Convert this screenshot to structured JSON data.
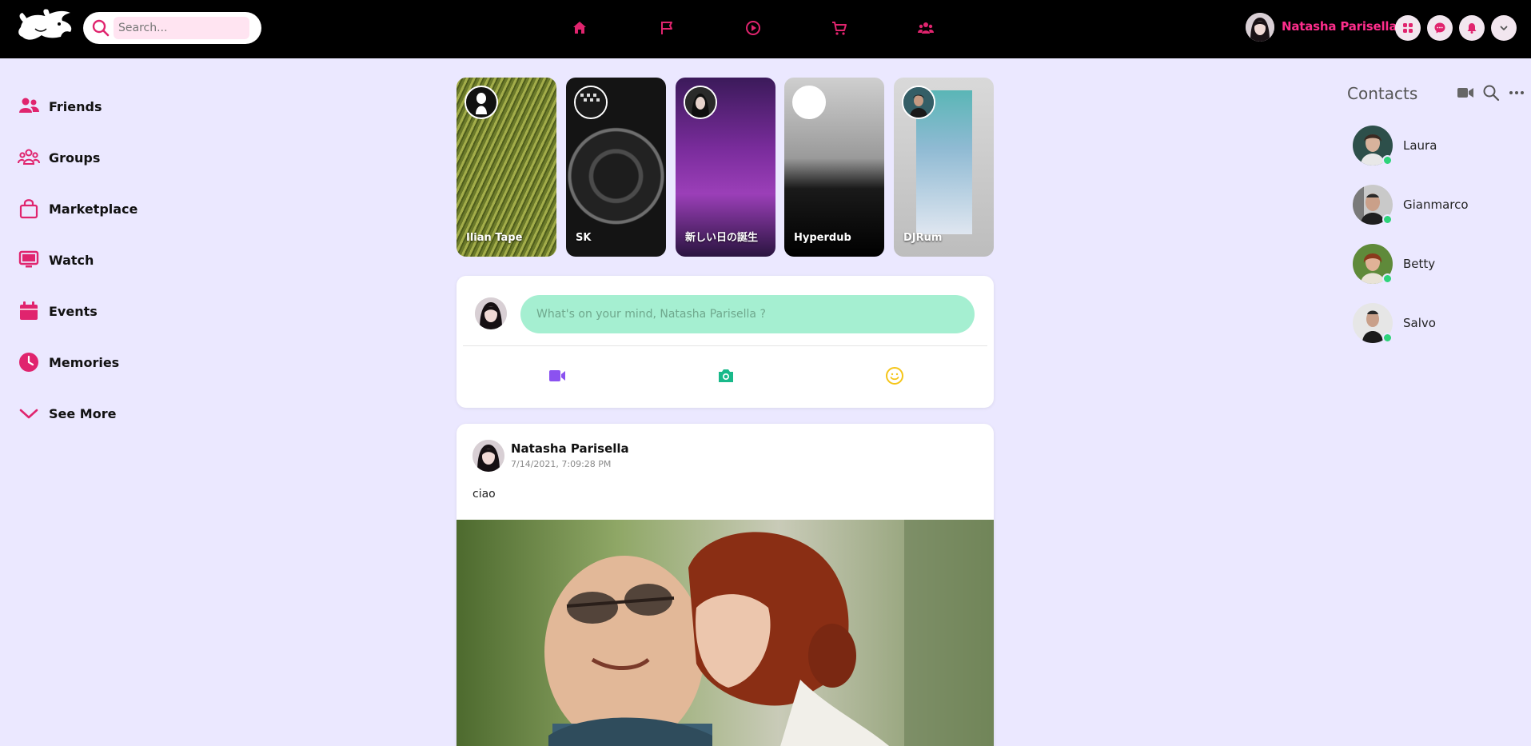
{
  "colors": {
    "accent": "#e0246e",
    "topbar": "#000000",
    "background": "#ebe8ff",
    "online": "#2ed37a",
    "composer_input": "#a5efd1"
  },
  "header": {
    "logo_icon": "flying-pig-logo",
    "search": {
      "placeholder": "Search...",
      "value": ""
    },
    "nav_icons": [
      "home-icon",
      "flag-icon",
      "play-icon",
      "cart-icon",
      "people-icon"
    ],
    "user_name": "Natasha Parisella",
    "action_icons": [
      "grid-icon",
      "messenger-icon",
      "bell-icon",
      "chevron-down-icon"
    ]
  },
  "sidebar": {
    "items": [
      {
        "label": "Friends",
        "icon": "friends-icon"
      },
      {
        "label": "Groups",
        "icon": "groups-icon"
      },
      {
        "label": "Marketplace",
        "icon": "bag-icon"
      },
      {
        "label": "Watch",
        "icon": "monitor-icon"
      },
      {
        "label": "Events",
        "icon": "calendar-icon"
      },
      {
        "label": "Memories",
        "icon": "clock-icon"
      },
      {
        "label": "See More",
        "icon": "chevron-down-icon"
      }
    ]
  },
  "stories": [
    {
      "name": "Ilian Tape"
    },
    {
      "name": "SK"
    },
    {
      "name": "新しい日の誕生"
    },
    {
      "name": "Hyperdub"
    },
    {
      "name": "DJRum"
    }
  ],
  "composer": {
    "placeholder": "What's on your mind, Natasha Parisella ?",
    "actions": [
      "video-icon",
      "camera-icon",
      "smile-icon"
    ]
  },
  "post": {
    "author": "Natasha Parisella",
    "time": "7/14/2021, 7:09:28 PM",
    "text": "ciao"
  },
  "contacts": {
    "title": "Contacts",
    "icons": [
      "video-icon",
      "search-icon",
      "more-icon"
    ],
    "people": [
      {
        "name": "Laura",
        "online": true
      },
      {
        "name": "Gianmarco",
        "online": true
      },
      {
        "name": "Betty",
        "online": true
      },
      {
        "name": "Salvo",
        "online": true
      }
    ]
  }
}
